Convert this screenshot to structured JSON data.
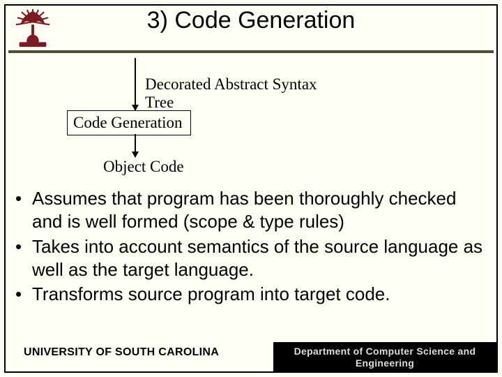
{
  "title": "3) Code Generation",
  "flow": {
    "input": "Decorated Abstract Syntax Tree",
    "box": "Code Generation",
    "output": "Object Code"
  },
  "bullets": [
    "Assumes that program has been thoroughly checked and is well formed (scope & type rules)",
    "Takes into account semantics of the source language as well as the target language.",
    "Transforms source program into target code."
  ],
  "footer": {
    "left": "UNIVERSITY OF SOUTH CAROLINA",
    "right": "Department of Computer Science and Engineering"
  },
  "logo": {
    "name": "usc-tree-seal-icon",
    "colors": {
      "primary": "#7a1b23",
      "bg": "#fffef5"
    }
  }
}
